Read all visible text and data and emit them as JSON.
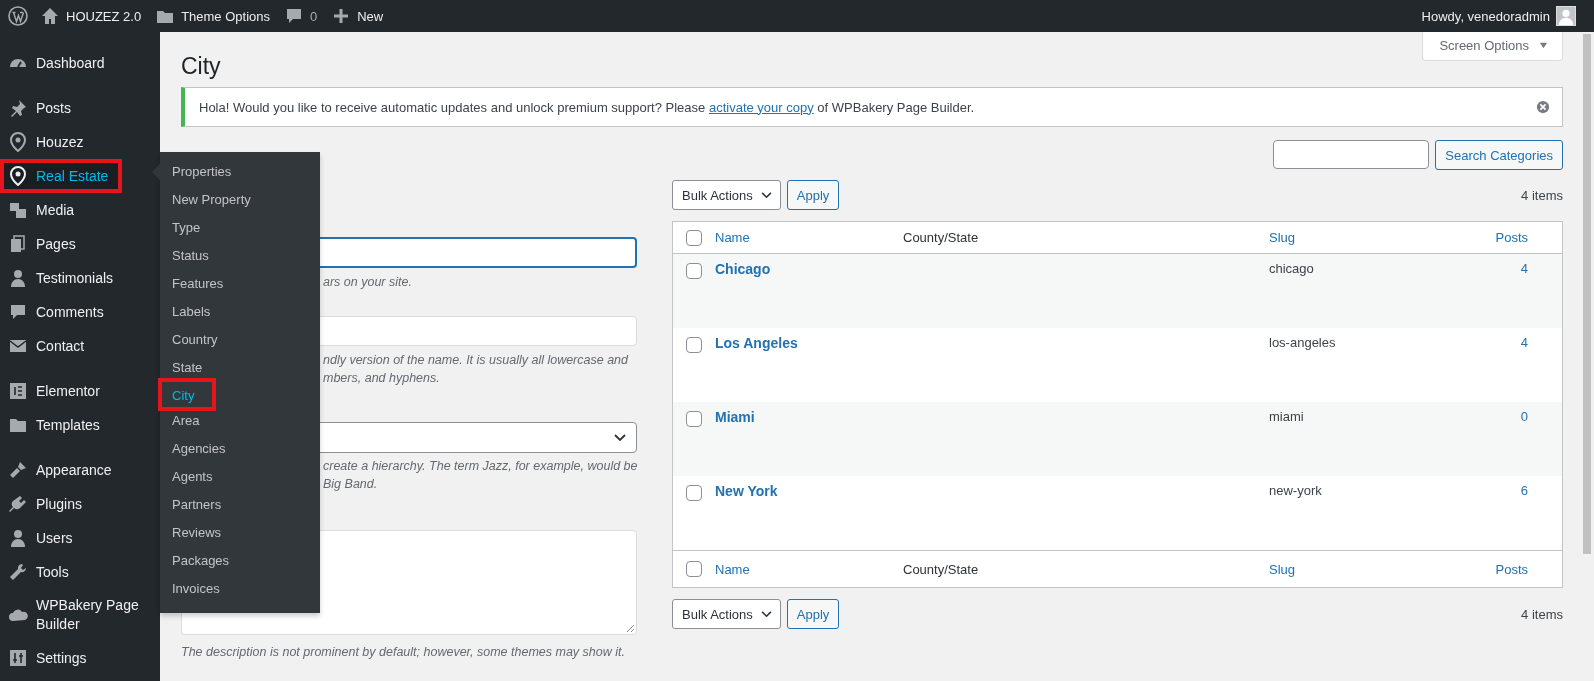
{
  "admin_bar": {
    "site": "HOUZEZ 2.0",
    "theme_options": "Theme Options",
    "comments": "0",
    "new": "New",
    "greeting": "Howdy, venedoradmin"
  },
  "sidebar": {
    "groups": [
      {
        "items": [
          {
            "label": "Dashboard",
            "selected": false,
            "highlighted": false
          }
        ]
      },
      {
        "items": [
          {
            "label": "Posts",
            "selected": false,
            "highlighted": false
          },
          {
            "label": "Houzez",
            "selected": false,
            "highlighted": false
          },
          {
            "label": "Real Estate",
            "selected": true,
            "highlighted": true
          },
          {
            "label": "Media",
            "selected": false,
            "highlighted": false
          },
          {
            "label": "Pages",
            "selected": false,
            "highlighted": false
          },
          {
            "label": "Testimonials",
            "selected": false,
            "highlighted": false
          },
          {
            "label": "Comments",
            "selected": false,
            "highlighted": false
          },
          {
            "label": "Contact",
            "selected": false,
            "highlighted": false
          }
        ]
      },
      {
        "items": [
          {
            "label": "Elementor",
            "selected": false,
            "highlighted": false
          },
          {
            "label": "Templates",
            "selected": false,
            "highlighted": false
          }
        ]
      },
      {
        "items": [
          {
            "label": "Appearance",
            "selected": false,
            "highlighted": false
          },
          {
            "label": "Plugins",
            "selected": false,
            "highlighted": false
          },
          {
            "label": "Users",
            "selected": false,
            "highlighted": false
          },
          {
            "label": "Tools",
            "selected": false,
            "highlighted": false
          },
          {
            "label": "WPBakery Page Builder",
            "selected": false,
            "highlighted": false
          },
          {
            "label": "Settings",
            "selected": false,
            "highlighted": false
          }
        ]
      }
    ]
  },
  "submenu": {
    "items": [
      {
        "label": "Properties",
        "selected": false,
        "highlighted": false
      },
      {
        "label": "New Property",
        "selected": false,
        "highlighted": false
      },
      {
        "label": "Type",
        "selected": false,
        "highlighted": false
      },
      {
        "label": "Status",
        "selected": false,
        "highlighted": false
      },
      {
        "label": "Features",
        "selected": false,
        "highlighted": false
      },
      {
        "label": "Labels",
        "selected": false,
        "highlighted": false
      },
      {
        "label": "Country",
        "selected": false,
        "highlighted": false
      },
      {
        "label": "State",
        "selected": false,
        "highlighted": false
      },
      {
        "label": "City",
        "selected": true,
        "highlighted": true
      },
      {
        "label": "Area",
        "selected": false,
        "highlighted": false
      },
      {
        "label": "Agencies",
        "selected": false,
        "highlighted": false
      },
      {
        "label": "Agents",
        "selected": false,
        "highlighted": false
      },
      {
        "label": "Partners",
        "selected": false,
        "highlighted": false
      },
      {
        "label": "Reviews",
        "selected": false,
        "highlighted": false
      },
      {
        "label": "Packages",
        "selected": false,
        "highlighted": false
      },
      {
        "label": "Invoices",
        "selected": false,
        "highlighted": false
      }
    ]
  },
  "page_title": "City",
  "screen_options": "Screen Options",
  "notice": {
    "before": "Hola! Would you like to receive automatic updates and unlock premium support? Please ",
    "link": "activate your copy",
    "after": " of WPBakery Page Builder."
  },
  "form": {
    "name_hint": [
      "ars on your site."
    ],
    "slug_hint": [
      "ndly version of the name. It is usually all lowercase and",
      "mbers, and hyphens."
    ],
    "parent_hint": [
      "create a hierarchy. The term Jazz, for example, would be",
      "Big Band."
    ],
    "description_hint": "The description is not prominent by default; however, some themes may show it."
  },
  "search": {
    "button": "Search Categories"
  },
  "tablenav_top": {
    "bulk": "Bulk Actions",
    "apply": "Apply",
    "count": "4 items"
  },
  "table": {
    "columns": [
      "Name",
      "County/State",
      "Slug",
      "Posts"
    ],
    "select_all_checked": false,
    "footer_columns": [
      "Name",
      "County/State",
      "Slug",
      "Posts"
    ],
    "footer_select_all_checked": false,
    "rows": [
      {
        "name": "Chicago",
        "slug": "chicago",
        "posts": "4",
        "checked": false
      },
      {
        "name": "Los Angeles",
        "slug": "los-angeles",
        "posts": "4",
        "checked": false
      },
      {
        "name": "Miami",
        "slug": "miami",
        "posts": "0",
        "checked": false
      },
      {
        "name": "New York",
        "slug": "new-york",
        "posts": "6",
        "checked": false
      }
    ]
  },
  "tablenav_bottom": {
    "bulk": "Bulk Actions",
    "apply": "Apply",
    "count": "4 items"
  }
}
